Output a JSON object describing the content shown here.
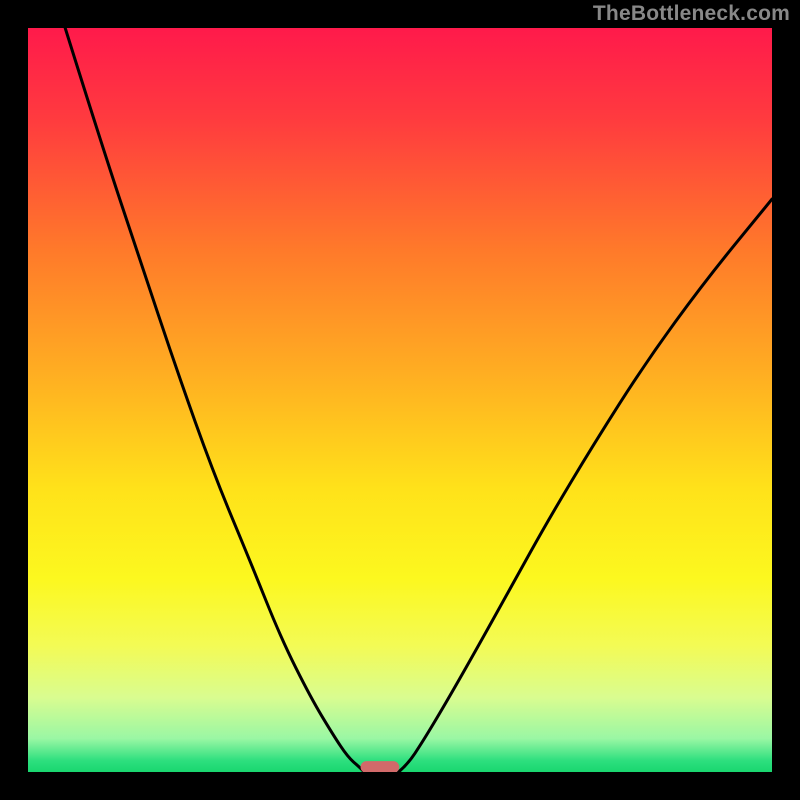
{
  "watermark": "TheBottleneck.com",
  "chart_data": {
    "type": "line",
    "title": "",
    "xlabel": "",
    "ylabel": "",
    "xlim": [
      0,
      100
    ],
    "ylim": [
      0,
      100
    ],
    "grid": false,
    "legend": false,
    "background_gradient_stops": [
      {
        "offset": 0.0,
        "color": "#ff1a4b"
      },
      {
        "offset": 0.12,
        "color": "#ff3a3f"
      },
      {
        "offset": 0.3,
        "color": "#ff7a2a"
      },
      {
        "offset": 0.48,
        "color": "#ffb321"
      },
      {
        "offset": 0.62,
        "color": "#ffe21a"
      },
      {
        "offset": 0.74,
        "color": "#fcf81f"
      },
      {
        "offset": 0.83,
        "color": "#f3fb55"
      },
      {
        "offset": 0.9,
        "color": "#d9fc90"
      },
      {
        "offset": 0.955,
        "color": "#9af7a4"
      },
      {
        "offset": 0.985,
        "color": "#2ddf7e"
      },
      {
        "offset": 1.0,
        "color": "#19d66f"
      }
    ],
    "series": [
      {
        "name": "left-branch",
        "x": [
          5,
          10,
          15,
          20,
          25,
          30,
          34,
          38,
          41,
          43,
          44.5,
          45.2
        ],
        "y": [
          100,
          84,
          69,
          54,
          40,
          28,
          18,
          10,
          5,
          2,
          0.7,
          0
        ]
      },
      {
        "name": "right-branch",
        "x": [
          49.8,
          51,
          53,
          56,
          60,
          65,
          70,
          76,
          83,
          91,
          100
        ],
        "y": [
          0,
          1,
          4,
          9,
          16,
          25,
          34,
          44,
          55,
          66,
          77
        ]
      }
    ],
    "marker": {
      "name": "optimal-zone",
      "x_center": 47.3,
      "y": 0,
      "width": 5.2,
      "height": 1.6,
      "color": "#d26a6a"
    }
  }
}
